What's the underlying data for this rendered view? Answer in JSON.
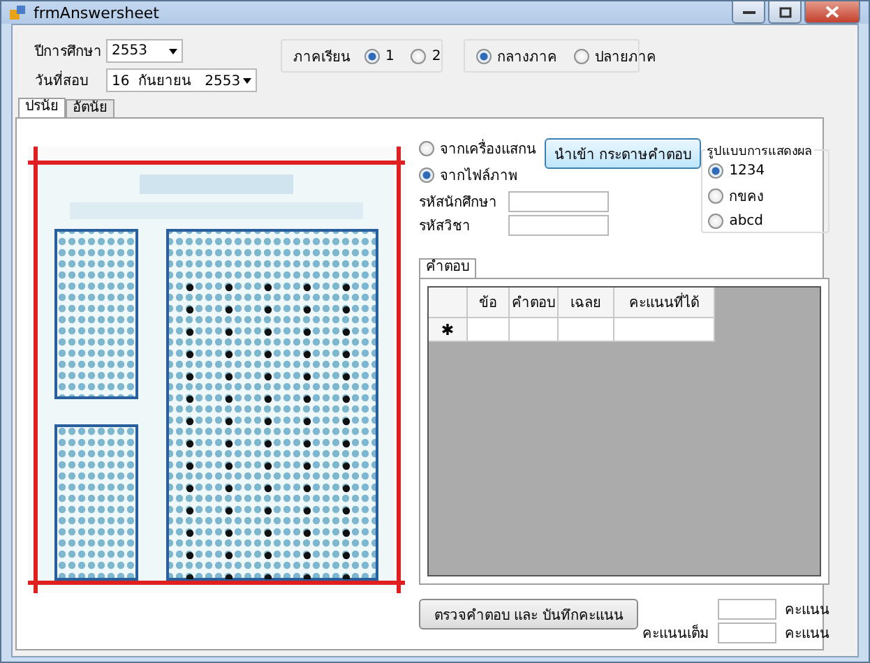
{
  "window": {
    "title": "frmAnswersheet"
  },
  "academic_year": {
    "label": "ปีการศึกษา",
    "value": "2553"
  },
  "exam_date": {
    "label": "วันที่สอบ",
    "day": "16",
    "month": "กันยายน",
    "year": "2553"
  },
  "semester": {
    "label": "ภาคเรียน",
    "options": [
      {
        "label": "1",
        "selected": true
      },
      {
        "label": "2",
        "selected": false
      }
    ]
  },
  "exam_period": {
    "options": [
      {
        "label": "กลางภาค",
        "selected": true
      },
      {
        "label": "ปลายภาค",
        "selected": false
      }
    ]
  },
  "tabs": [
    {
      "label": "ปรนัย",
      "selected": true
    },
    {
      "label": "อัตนัย",
      "selected": false
    }
  ],
  "source": {
    "options": [
      {
        "label": "จากเครื่องแสกน",
        "selected": false
      },
      {
        "label": "จากไฟล์ภาพ",
        "selected": true
      }
    ]
  },
  "import_button": "นำเข้า กระดาษคำตอบ",
  "fields": [
    {
      "label": "รหัสนักศึกษา"
    },
    {
      "label": "รหัสวิชา"
    }
  ],
  "display_format": {
    "title": "รูปแบบการแสดงผล",
    "options": [
      {
        "label": "1234",
        "selected": true
      },
      {
        "label": "กขคง",
        "selected": false
      },
      {
        "label": "abcd",
        "selected": false
      }
    ]
  },
  "answers": {
    "tab": "คำตอบ",
    "columns": [
      "ข้อ",
      "คำตอบ",
      "เฉลย",
      "คะแนนที่ได้"
    ],
    "new_row_marker": "✱"
  },
  "check_button": "ตรวจคำตอบ และ บันทึกคะแนน",
  "score": {
    "unit": "คะแนน"
  },
  "full_score": {
    "label": "คะแนนเต็ม",
    "unit": "คะแนน"
  }
}
